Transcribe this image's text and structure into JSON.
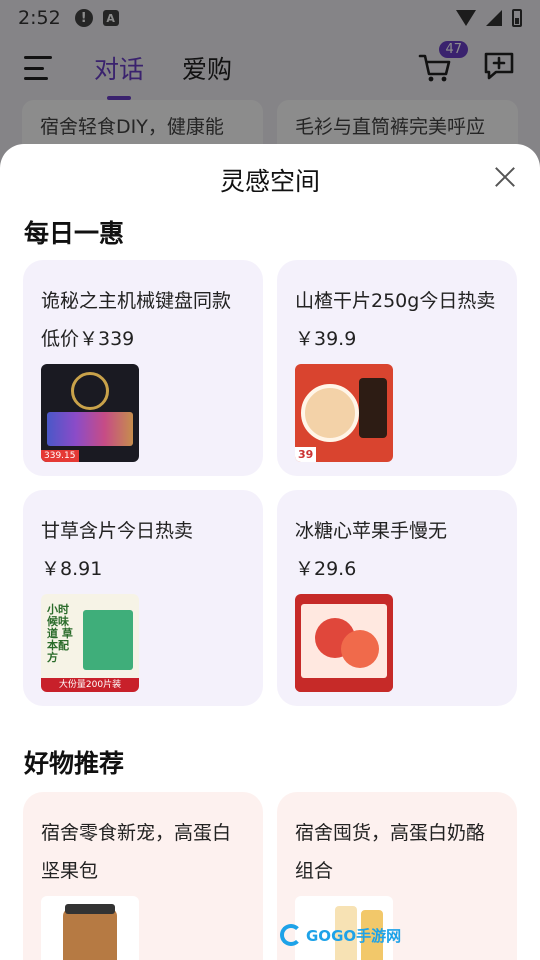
{
  "status_bar": {
    "time": "2:52"
  },
  "nav": {
    "tabs": [
      {
        "label": "对话",
        "active": true
      },
      {
        "label": "爱购",
        "active": false
      }
    ],
    "cart_count": "47"
  },
  "background_cards": [
    "宿舍轻食DIY，健康能",
    "毛衫与直筒裤完美呼应"
  ],
  "sheet": {
    "title": "灵感空间",
    "daily_deals": {
      "heading": "每日一惠",
      "items": [
        {
          "title": "诡秘之主机械键盘同款低价￥339",
          "thumb_price": "339.15"
        },
        {
          "title": "山楂干片250g今日热卖￥39.9",
          "thumb_price": "39"
        },
        {
          "title": "甘草含片今日热卖￥8.91",
          "thumb_text": "小时候味道 草本配方",
          "thumb_bar": "大份量200片装"
        },
        {
          "title": "冰糖心苹果手慢无￥29.6"
        }
      ]
    },
    "recommendations": {
      "heading": "好物推荐",
      "items": [
        {
          "title": "宿舍零食新宠，高蛋白坚果包"
        },
        {
          "title": "宿舍囤货，高蛋白奶酪组合"
        }
      ]
    }
  },
  "watermark": {
    "text": "GOGO手游网"
  },
  "colors": {
    "accent": "#6a3fc8",
    "deal_card_bg": "#f4f1fb",
    "recommend_card_bg": "#fdf1ef"
  }
}
